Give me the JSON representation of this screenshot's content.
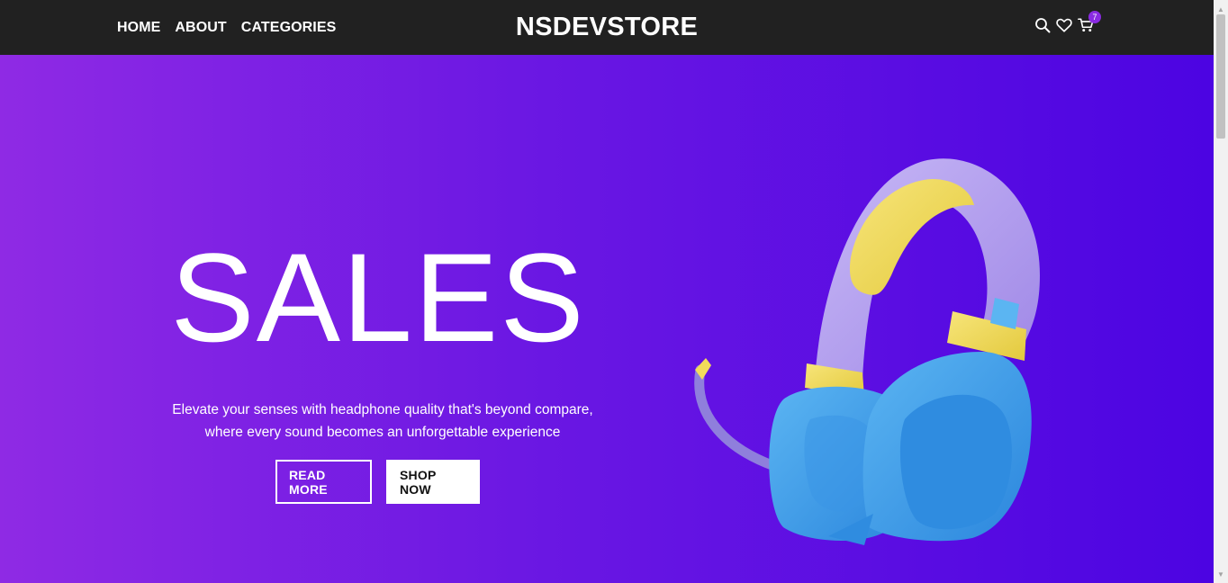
{
  "nav": {
    "links": [
      "HOME",
      "ABOUT",
      "CATEGORIES"
    ],
    "brand": "NSDEVSTORE",
    "icons": [
      "search-icon",
      "heart-icon",
      "cart-icon"
    ],
    "cart_count": "7"
  },
  "hero": {
    "title": "SALES",
    "description_line1": "Elevate your senses with headphone quality that's beyond compare,",
    "description_line2": "where every sound becomes an unforgettable experience",
    "read_more": "READ MORE",
    "shop_now": "SHOP NOW"
  },
  "colors": {
    "nav_bg": "#212121",
    "hero_gradient_start": "#8f2ae4",
    "hero_gradient_end": "#4c04e2",
    "badge": "#8a2be2",
    "headphone_band": "#b7a6f0",
    "headphone_cushion": "#f2dc5a",
    "headphone_cup": "#3fa1ec"
  }
}
